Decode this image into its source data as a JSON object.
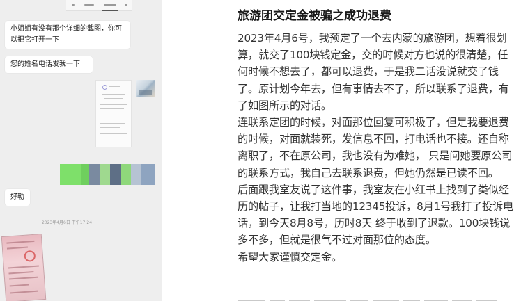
{
  "chat": {
    "messages": [
      {
        "text": "小姐姐有没有那个详细的截图，你可以把它打开一下"
      },
      {
        "text": "您的姓名电话发我一下"
      },
      {
        "text": "好勒"
      }
    ],
    "timestamp": "2023年4月6日 下午17:24"
  },
  "article": {
    "title": "旅游团交定金被骗之成功退费",
    "paragraphs": [
      "2023年4月6号，我预定了一个去内蒙的旅游团，想着很划算，就交了100块钱定金，交的时候对方也说的很清楚，任何时候不想去了，都可以退费，于是我二话没说就交了钱了。原计划今年去，但有事情去不了，所以联系了退费，有了如图所示的对话。",
      "连联系定团的时候，对面那位回复可积极了，但是我要退费的时候，对面就装死，发信息不回，打电话也不接。还自称离职了，不在原公司，我也没有为难她， 只是问她要原公司的联系方式，我自己去联系退费，但她仍然是已读不回。",
      "后面跟我室友说了这件事，我室友在小红书上找到了类似经历的帖子，让我打当地的12345投诉，8月1号我打了投诉电话，到今天8月8号，历时8天 终于收到了退款。100块钱说多不多，但就是很气不过对面那位的态度。",
      "希望大家谨慎交定金。"
    ]
  },
  "colors": {
    "chat_bg": "#eeeeee",
    "bubble_bg": "#ffffff",
    "mosaic_green": "#7ee06a",
    "text": "#333333"
  }
}
